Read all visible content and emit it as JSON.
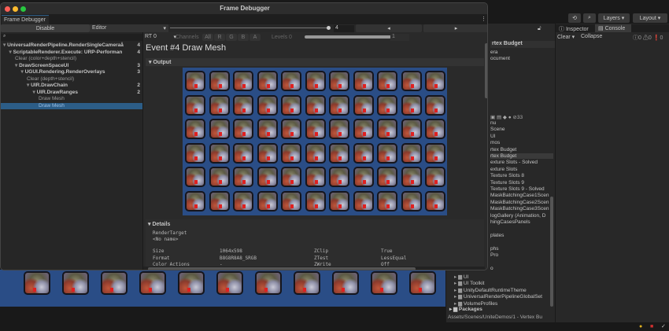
{
  "window": {
    "title": "Frame Debugger",
    "tab": "Frame Debugger"
  },
  "toolbar": {
    "disable_label": "Disable",
    "target": "Editor",
    "event_index": "4",
    "rt": "RT 0",
    "channels_label": "Channels",
    "channels": [
      "All",
      "R",
      "G",
      "B",
      "A"
    ],
    "levels_label": "Levels",
    "levels_min": "0",
    "levels_max": "1"
  },
  "tree": [
    {
      "label": "UniversalRenderPipeline.RenderSingleCameraå",
      "count": "4",
      "indent": 0,
      "bold": true,
      "arrow": true
    },
    {
      "label": "ScriptableRenderer.Execute: URP-Performan",
      "count": "4",
      "indent": 1,
      "bold": true,
      "arrow": true
    },
    {
      "label": "Clear (color+depth+stencil)",
      "count": "",
      "indent": 2,
      "bold": false,
      "arrow": false
    },
    {
      "label": "DrawScreenSpaceUI",
      "count": "3",
      "indent": 2,
      "bold": true,
      "arrow": true
    },
    {
      "label": "UGUI.Rendering.RenderOverlays",
      "count": "3",
      "indent": 3,
      "bold": true,
      "arrow": true
    },
    {
      "label": "Clear (depth+stencil)",
      "count": "",
      "indent": 4,
      "bold": false,
      "arrow": false
    },
    {
      "label": "UIR.DrawChain",
      "count": "2",
      "indent": 4,
      "bold": true,
      "arrow": true
    },
    {
      "label": "UIR.DrawRanges",
      "count": "2",
      "indent": 5,
      "bold": true,
      "arrow": true
    },
    {
      "label": "Draw Mesh",
      "count": "",
      "indent": 6,
      "bold": false,
      "arrow": false
    },
    {
      "label": "Draw Mesh",
      "count": "",
      "indent": 6,
      "bold": false,
      "arrow": false,
      "selected": true
    }
  ],
  "event": {
    "title": "Event #4 Draw Mesh",
    "output_label": "Output",
    "details_label": "Details",
    "render_target_label": "RenderTarget",
    "render_target": "<No name>",
    "rows": [
      [
        "Size",
        "1064x598",
        "ZClip",
        "True"
      ],
      [
        "Format",
        "B8G8R8A8_SRGB",
        "ZTest",
        "LessEqual"
      ],
      [
        "Color Actions",
        "-",
        "ZWrite",
        "Off"
      ]
    ]
  },
  "editor_top": {
    "layers": "Layers",
    "layout": "Layout"
  },
  "inspector": {
    "tab_inspector": "Inspector",
    "tab_console": "Console",
    "clear": "Clear",
    "collapse": "Collapse",
    "logs": "0",
    "warnings": "0",
    "errors": "0"
  },
  "hierarchy": {
    "scene": "rtex Budget",
    "items": [
      "era",
      "ocument"
    ]
  },
  "project": {
    "hidden_count": "33",
    "items": [
      "nu",
      "Scene",
      "UI",
      "mos",
      "rtex Budget",
      "rtex Budget",
      "exture Slots - Solved",
      "exture Slots",
      "Texture Slots 8",
      "Texture Slots 9",
      "Texture Slots 9 - Solved",
      "MaskBatchingCase1Scen",
      "MaskBatchingCase2Scen",
      "MaskBatchingCase3Scen",
      "logGallery (Animation, D",
      "hingCasesPanels",
      "",
      "plates",
      "",
      "phs",
      "Pro",
      "",
      "o"
    ],
    "folders": [
      "UI",
      "UI Toolkit",
      "UnityDefaultRuntimeTheme",
      "UniversalRenderPipelineGlobalSet",
      "VolumeProfiles"
    ],
    "packages": "Packages",
    "path": "Assets/Scenes/UniteDemos/1 - Vertex Bu"
  },
  "colors": {
    "accent": "#2c5d87",
    "render_bg": "#2a4d86"
  }
}
